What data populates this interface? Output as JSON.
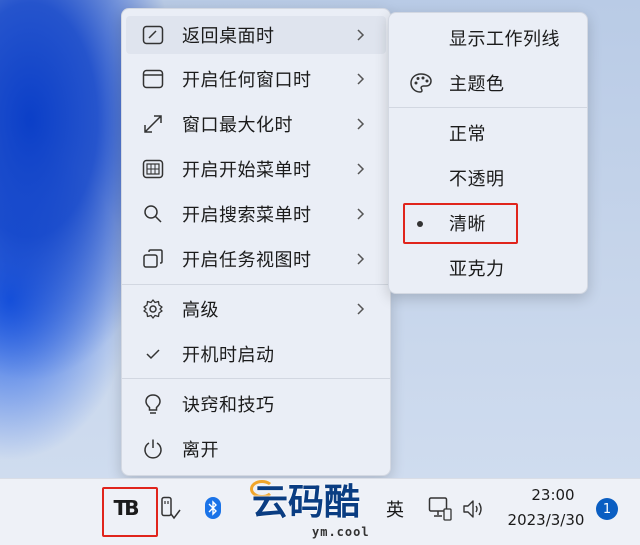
{
  "main_menu": {
    "items": [
      {
        "label": "返回桌面时",
        "icon": "desktop-icon",
        "submenu": true
      },
      {
        "label": "开启任何窗口时",
        "icon": "window-icon",
        "submenu": true
      },
      {
        "label": "窗口最大化时",
        "icon": "maximize-icon",
        "submenu": true
      },
      {
        "label": "开启开始菜单时",
        "icon": "start-menu-icon",
        "submenu": true
      },
      {
        "label": "开启搜索菜单时",
        "icon": "search-icon",
        "submenu": true
      },
      {
        "label": "开启任务视图时",
        "icon": "task-view-icon",
        "submenu": true
      },
      {
        "label": "高级",
        "icon": "gear-icon",
        "submenu": true
      },
      {
        "label": "开机时启动",
        "icon": "checkmark-icon",
        "submenu": false
      },
      {
        "label": "诀窍和技巧",
        "icon": "lightbulb-icon",
        "submenu": false
      },
      {
        "label": "离开",
        "icon": "power-icon",
        "submenu": false
      }
    ]
  },
  "sub_menu": {
    "items": [
      {
        "label": "显示工作列线"
      },
      {
        "label": "主题色",
        "icon": "palette-icon"
      },
      {
        "label": "正常"
      },
      {
        "label": "不透明"
      },
      {
        "label": "清晰",
        "selected": true
      },
      {
        "label": "亚克力"
      }
    ]
  },
  "taskbar": {
    "app_logo": "TB",
    "ime_label": "英",
    "clock_time": "23:00",
    "clock_date": "2023/3/30",
    "notification_count": "1"
  },
  "watermark": {
    "text_cn": "云码酷",
    "text_en": "ym.cool"
  },
  "colors": {
    "highlight": "#e0241c",
    "badge": "#0a5ec2",
    "bluetooth": "#1a73e8"
  }
}
